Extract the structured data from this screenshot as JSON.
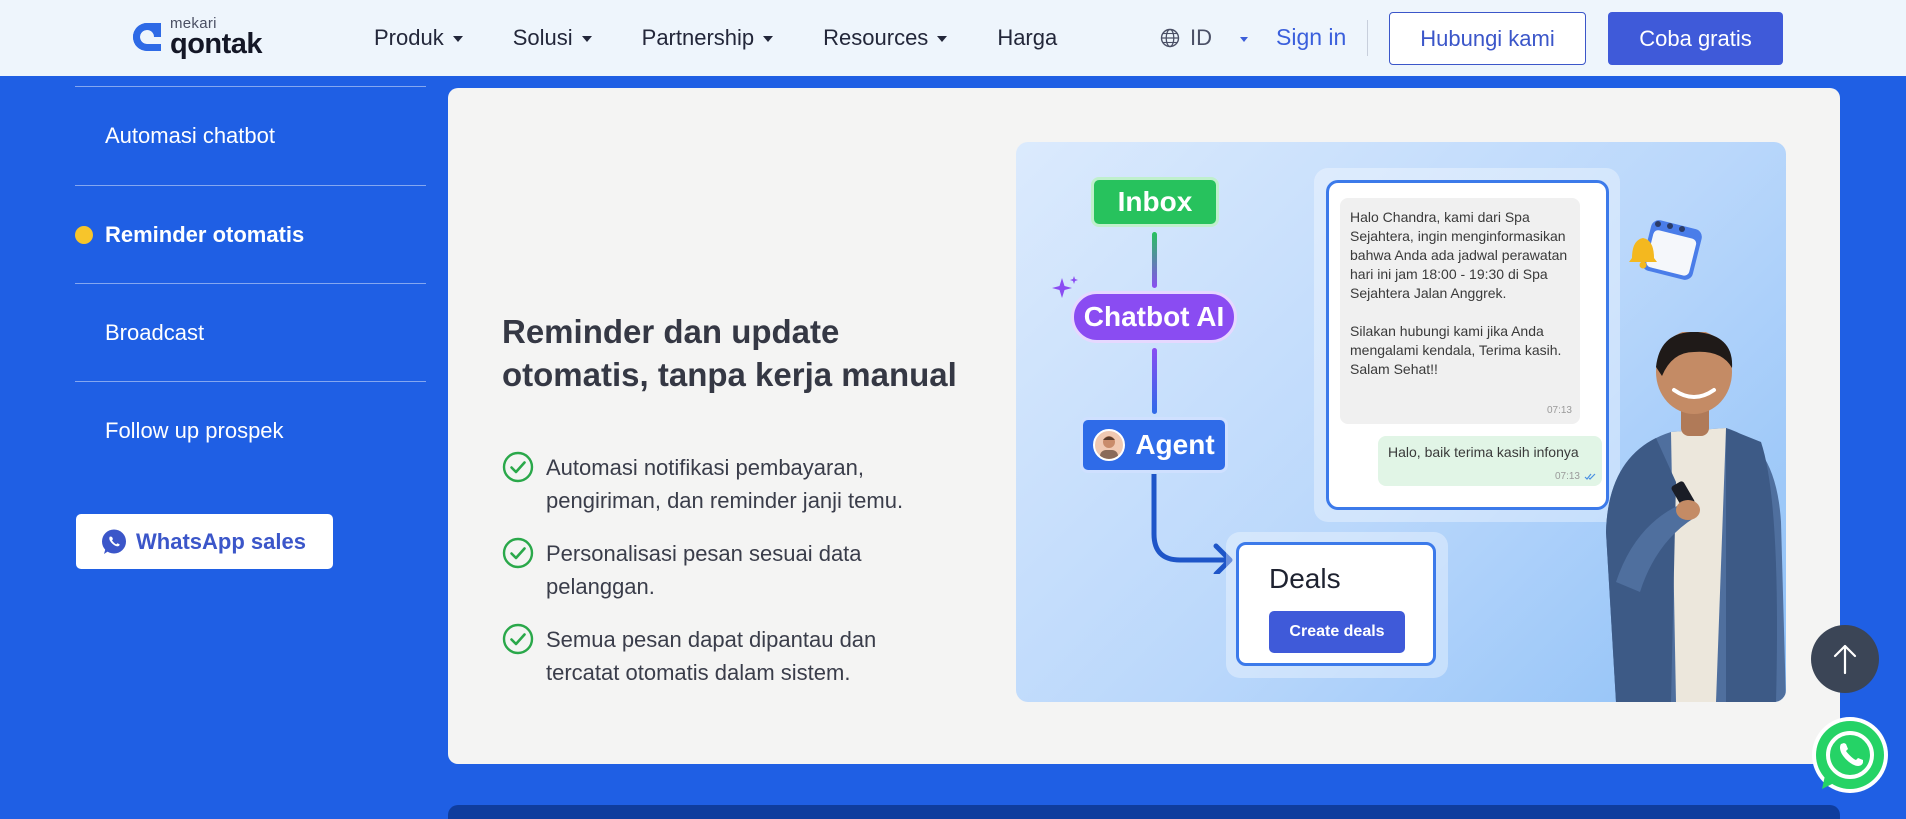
{
  "brand": {
    "sub": "mekari",
    "name": "qontak"
  },
  "nav": {
    "items": [
      {
        "label": "Produk",
        "dropdown": true
      },
      {
        "label": "Solusi",
        "dropdown": true
      },
      {
        "label": "Partnership",
        "dropdown": true
      },
      {
        "label": "Resources",
        "dropdown": true
      },
      {
        "label": "Harga",
        "dropdown": false
      }
    ],
    "language": "ID",
    "signin": "Sign in",
    "contact_button": "Hubungi kami",
    "trial_button": "Coba gratis"
  },
  "sidebar": {
    "items": [
      {
        "label": "Automasi chatbot",
        "active": false
      },
      {
        "label": "Reminder otomatis",
        "active": true
      },
      {
        "label": "Broadcast",
        "active": false
      },
      {
        "label": "Follow up prospek",
        "active": false
      }
    ],
    "whatsapp_button": "WhatsApp sales"
  },
  "content": {
    "title": "Reminder dan update otomatis, tanpa kerja manual",
    "features": [
      "Automasi notifikasi pembayaran, pengiriman, dan reminder janji temu.",
      "Personalisasi pesan sesuai data pelanggan.",
      "Semua pesan dapat dipantau dan tercatat otomatis dalam sistem."
    ]
  },
  "illustration": {
    "flow": {
      "inbox": "Inbox",
      "chatbot": "Chatbot AI",
      "agent": "Agent"
    },
    "chat": {
      "incoming_p1": "Halo Chandra, kami dari Spa Sejahtera, ingin menginformasikan bahwa Anda ada jadwal perawatan hari ini jam 18:00 - 19:30 di Spa Sejahtera Jalan Anggrek.",
      "incoming_p2": "Silakan hubungi kami jika Anda mengalami kendala, Terima kasih. Salam Sehat!!",
      "incoming_time": "07:13",
      "outgoing": "Halo, baik terima kasih infonya",
      "outgoing_time": "07:13"
    },
    "deals": {
      "title": "Deals",
      "button": "Create deals"
    }
  },
  "colors": {
    "background_blue": "#1f5fe4",
    "accent": "#3f5ad9",
    "active_dot": "#f7c52b",
    "check_green": "#2aa84a",
    "inbox_green": "#27c25d",
    "chatbot_purple": "#8a4cf2",
    "agent_blue": "#2f6be8"
  },
  "icons": {
    "globe": "globe-icon",
    "check": "check-circle-icon",
    "whatsapp": "whatsapp-icon",
    "scroll_top": "arrow-up-icon"
  }
}
